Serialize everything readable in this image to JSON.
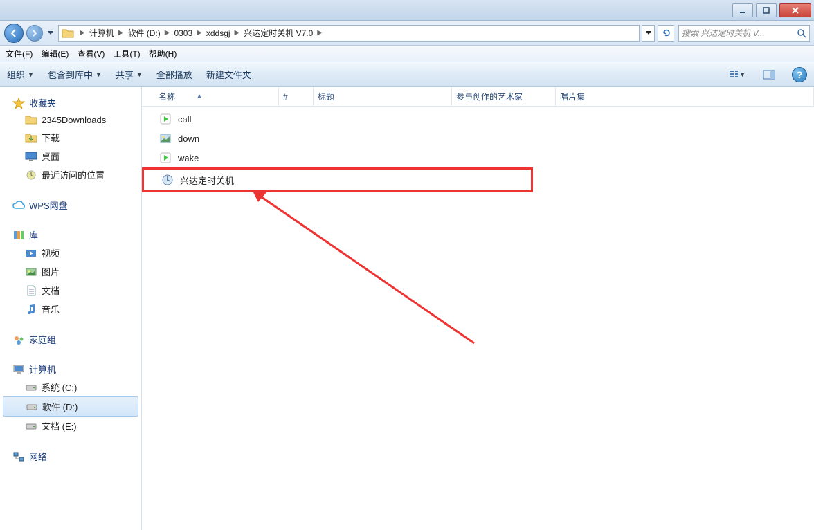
{
  "window_controls": {
    "minimize": "minimize",
    "maximize": "maximize",
    "close": "close"
  },
  "breadcrumb": {
    "items": [
      "计算机",
      "软件 (D:)",
      "0303",
      "xddsgj",
      "兴达定时关机 V7.0"
    ]
  },
  "search": {
    "placeholder": "搜索 兴达定时关机 V..."
  },
  "menu": {
    "file": "文件(F)",
    "edit": "编辑(E)",
    "view": "查看(V)",
    "tools": "工具(T)",
    "help": "帮助(H)"
  },
  "toolbar": {
    "organize": "组织",
    "include": "包含到库中",
    "share": "共享",
    "playall": "全部播放",
    "newfolder": "新建文件夹"
  },
  "sidebar": {
    "favorites": {
      "label": "收藏夹",
      "items": [
        "2345Downloads",
        "下载",
        "桌面",
        "最近访问的位置"
      ]
    },
    "wps": {
      "label": "WPS网盘"
    },
    "libraries": {
      "label": "库",
      "items": [
        "视频",
        "图片",
        "文档",
        "音乐"
      ]
    },
    "homegroup": {
      "label": "家庭组"
    },
    "computer": {
      "label": "计算机",
      "items": [
        "系统 (C:)",
        "软件 (D:)",
        "文档 (E:)"
      ]
    },
    "network": {
      "label": "网络"
    }
  },
  "columns": {
    "name": "名称",
    "num": "#",
    "title": "标题",
    "artist": "参与创作的艺术家",
    "album": "唱片集"
  },
  "files": [
    {
      "name": "call",
      "icon": "media"
    },
    {
      "name": "down",
      "icon": "image"
    },
    {
      "name": "wake",
      "icon": "media"
    },
    {
      "name": "兴达定时关机",
      "icon": "app"
    }
  ]
}
